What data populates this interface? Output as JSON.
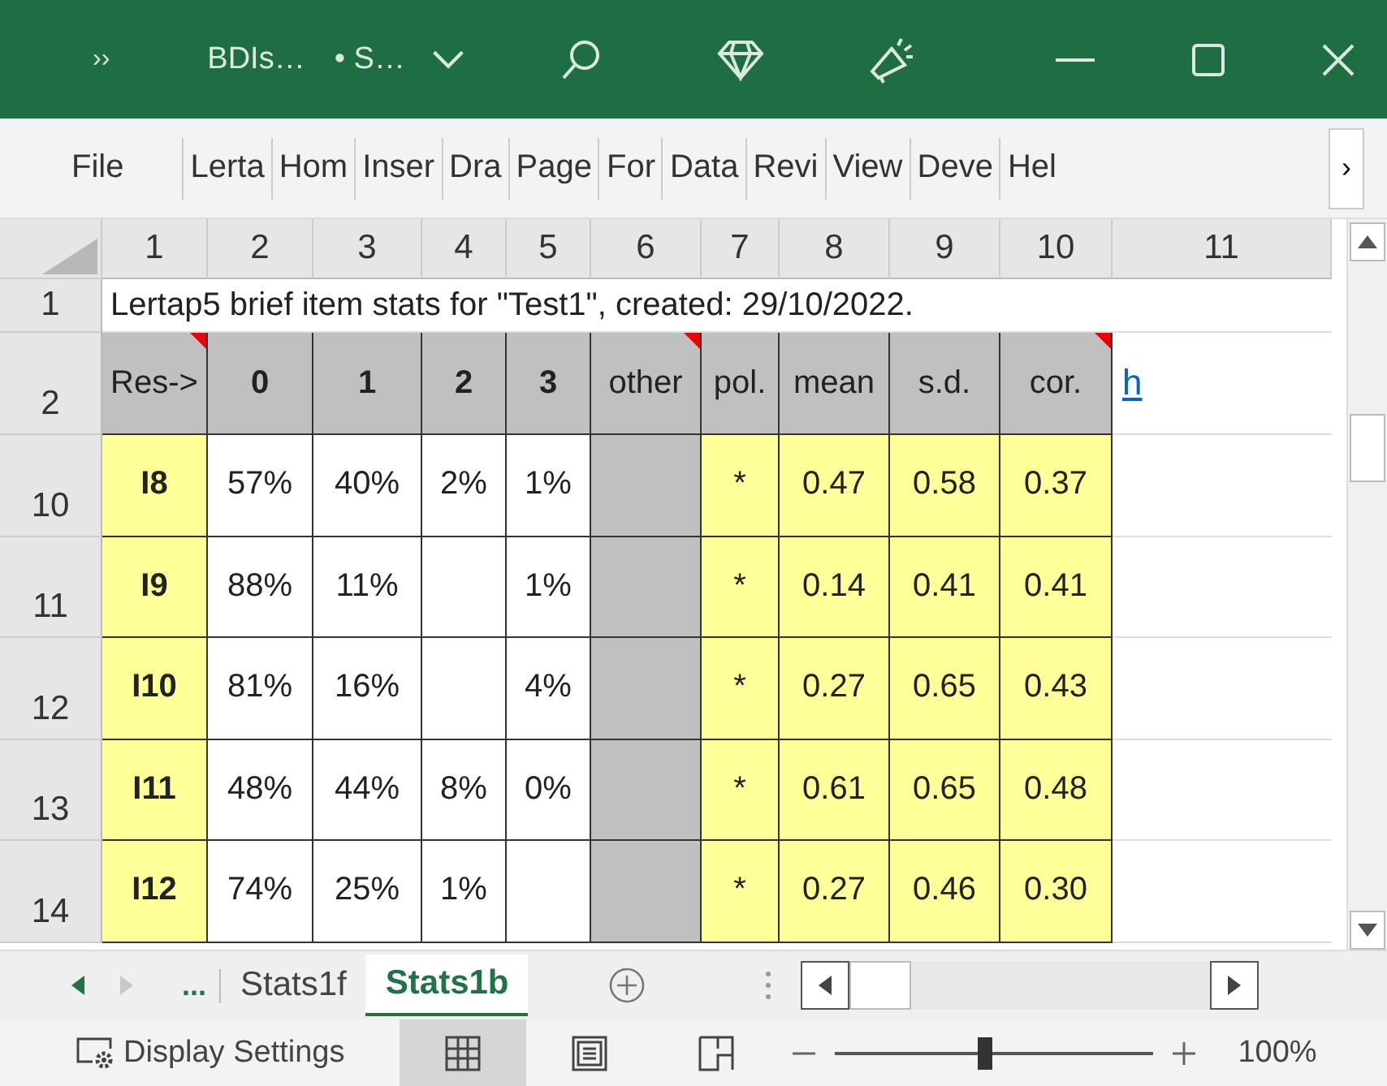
{
  "window": {
    "overflow": "››",
    "title": "BDIs…",
    "subtitle": "• S…"
  },
  "ribbon_tabs": [
    "File",
    "Lerta",
    "Hom",
    "Inser",
    "Dra",
    "Page",
    "For",
    "Data",
    "Revi",
    "View",
    "Deve",
    "Hel"
  ],
  "ribbon_more": "›",
  "sheet": {
    "column_headers": [
      "1",
      "2",
      "3",
      "4",
      "5",
      "6",
      "7",
      "8",
      "9",
      "10",
      "11"
    ],
    "title_row": {
      "row": "1",
      "text": "Lertap5 brief item stats for \"Test1\", created: 29/10/2022."
    },
    "header_row": {
      "row": "2",
      "link": "h",
      "cells": [
        {
          "text": "Res->",
          "comment": true
        },
        {
          "text": "0",
          "comment": false
        },
        {
          "text": "1",
          "comment": false
        },
        {
          "text": "2",
          "comment": false
        },
        {
          "text": "3",
          "comment": false
        },
        {
          "text": "other",
          "comment": true
        },
        {
          "text": "pol.",
          "comment": false
        },
        {
          "text": "mean",
          "comment": false
        },
        {
          "text": "s.d.",
          "comment": false
        },
        {
          "text": "cor.",
          "comment": true
        }
      ]
    },
    "rows": [
      {
        "row": "10",
        "cells": [
          "I8",
          "57%",
          "40%",
          "2%",
          "1%",
          null,
          "*",
          "0.47",
          "0.58",
          "0.37"
        ]
      },
      {
        "row": "11",
        "cells": [
          "I9",
          "88%",
          "11%",
          null,
          "1%",
          null,
          "*",
          "0.14",
          "0.41",
          "0.41"
        ]
      },
      {
        "row": "12",
        "cells": [
          "I10",
          "81%",
          "16%",
          null,
          "4%",
          null,
          "*",
          "0.27",
          "0.65",
          "0.43"
        ]
      },
      {
        "row": "13",
        "cells": [
          "I11",
          "48%",
          "44%",
          "8%",
          "0%",
          null,
          "*",
          "0.61",
          "0.65",
          "0.48"
        ]
      },
      {
        "row": "14",
        "cells": [
          "I12",
          "74%",
          "25%",
          "1%",
          null,
          null,
          "*",
          "0.27",
          "0.46",
          "0.30"
        ]
      }
    ]
  },
  "sheet_tabs": {
    "more": "...",
    "tabs": [
      {
        "label": "Stats1f",
        "selected": false
      },
      {
        "label": "Stats1b",
        "selected": true
      }
    ]
  },
  "status_bar": {
    "display_settings": "Display Settings",
    "views": [
      {
        "kind": "normal",
        "selected": true
      },
      {
        "kind": "layout",
        "selected": false
      },
      {
        "kind": "break",
        "selected": false
      }
    ],
    "zoom": {
      "level": 0.47,
      "reading": "100%"
    }
  }
}
